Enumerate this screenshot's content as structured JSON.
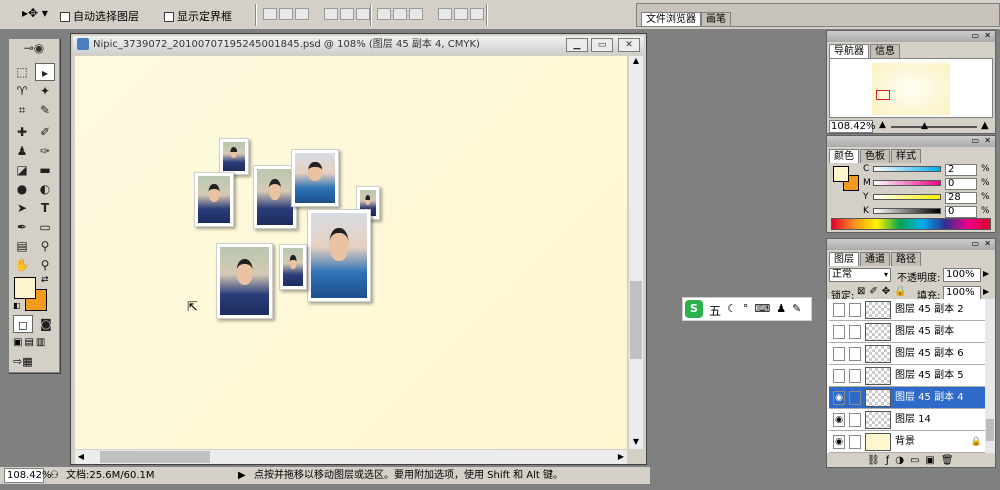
{
  "options_bar": {
    "auto_select_label": "自动选择图层",
    "show_bounds_label": "显示定界框",
    "tab_file_browser": "文件浏览器",
    "tab_brush": "画笔"
  },
  "document": {
    "title": "Nipic_3739072_20100707195245001845.psd @ 108% (图层 45 副本 4, CMYK)",
    "zoom": "108.42%",
    "doc_size": "文档:25.6M/60.1M",
    "hint": "点按并拖移以移动图层或选区。要用附加选项，使用 Shift 和 Alt 键。"
  },
  "navigator": {
    "tab_nav": "导航器",
    "tab_info": "信息",
    "zoom": "108.42%"
  },
  "color_panel": {
    "tab_color": "颜色",
    "tab_swatches": "色板",
    "tab_styles": "样式",
    "channels": [
      {
        "name": "C",
        "value": "2",
        "unit": "%"
      },
      {
        "name": "M",
        "value": "0",
        "unit": "%"
      },
      {
        "name": "Y",
        "value": "28",
        "unit": "%"
      },
      {
        "name": "K",
        "value": "0",
        "unit": "%"
      }
    ]
  },
  "layers_panel": {
    "tab_layers": "图层",
    "tab_channels": "通道",
    "tab_paths": "路径",
    "blend_mode": "正常",
    "opacity_label": "不透明度:",
    "opacity": "100%",
    "lock_label": "锁定:",
    "fill_label": "填充:",
    "fill": "100%",
    "layers": [
      {
        "name": "图层 45 副本 2"
      },
      {
        "name": "图层 45 副本"
      },
      {
        "name": "图层 45 副本 6"
      },
      {
        "name": "图层 45 副本 5"
      },
      {
        "name": "图层 45 副本 4"
      },
      {
        "name": "图层 14"
      },
      {
        "name": "背景"
      }
    ]
  },
  "ime": {
    "label": "五"
  },
  "colors": {
    "foreground": "#fff5cc",
    "background": "#f29b1d",
    "selection": "#2f6ac9"
  }
}
